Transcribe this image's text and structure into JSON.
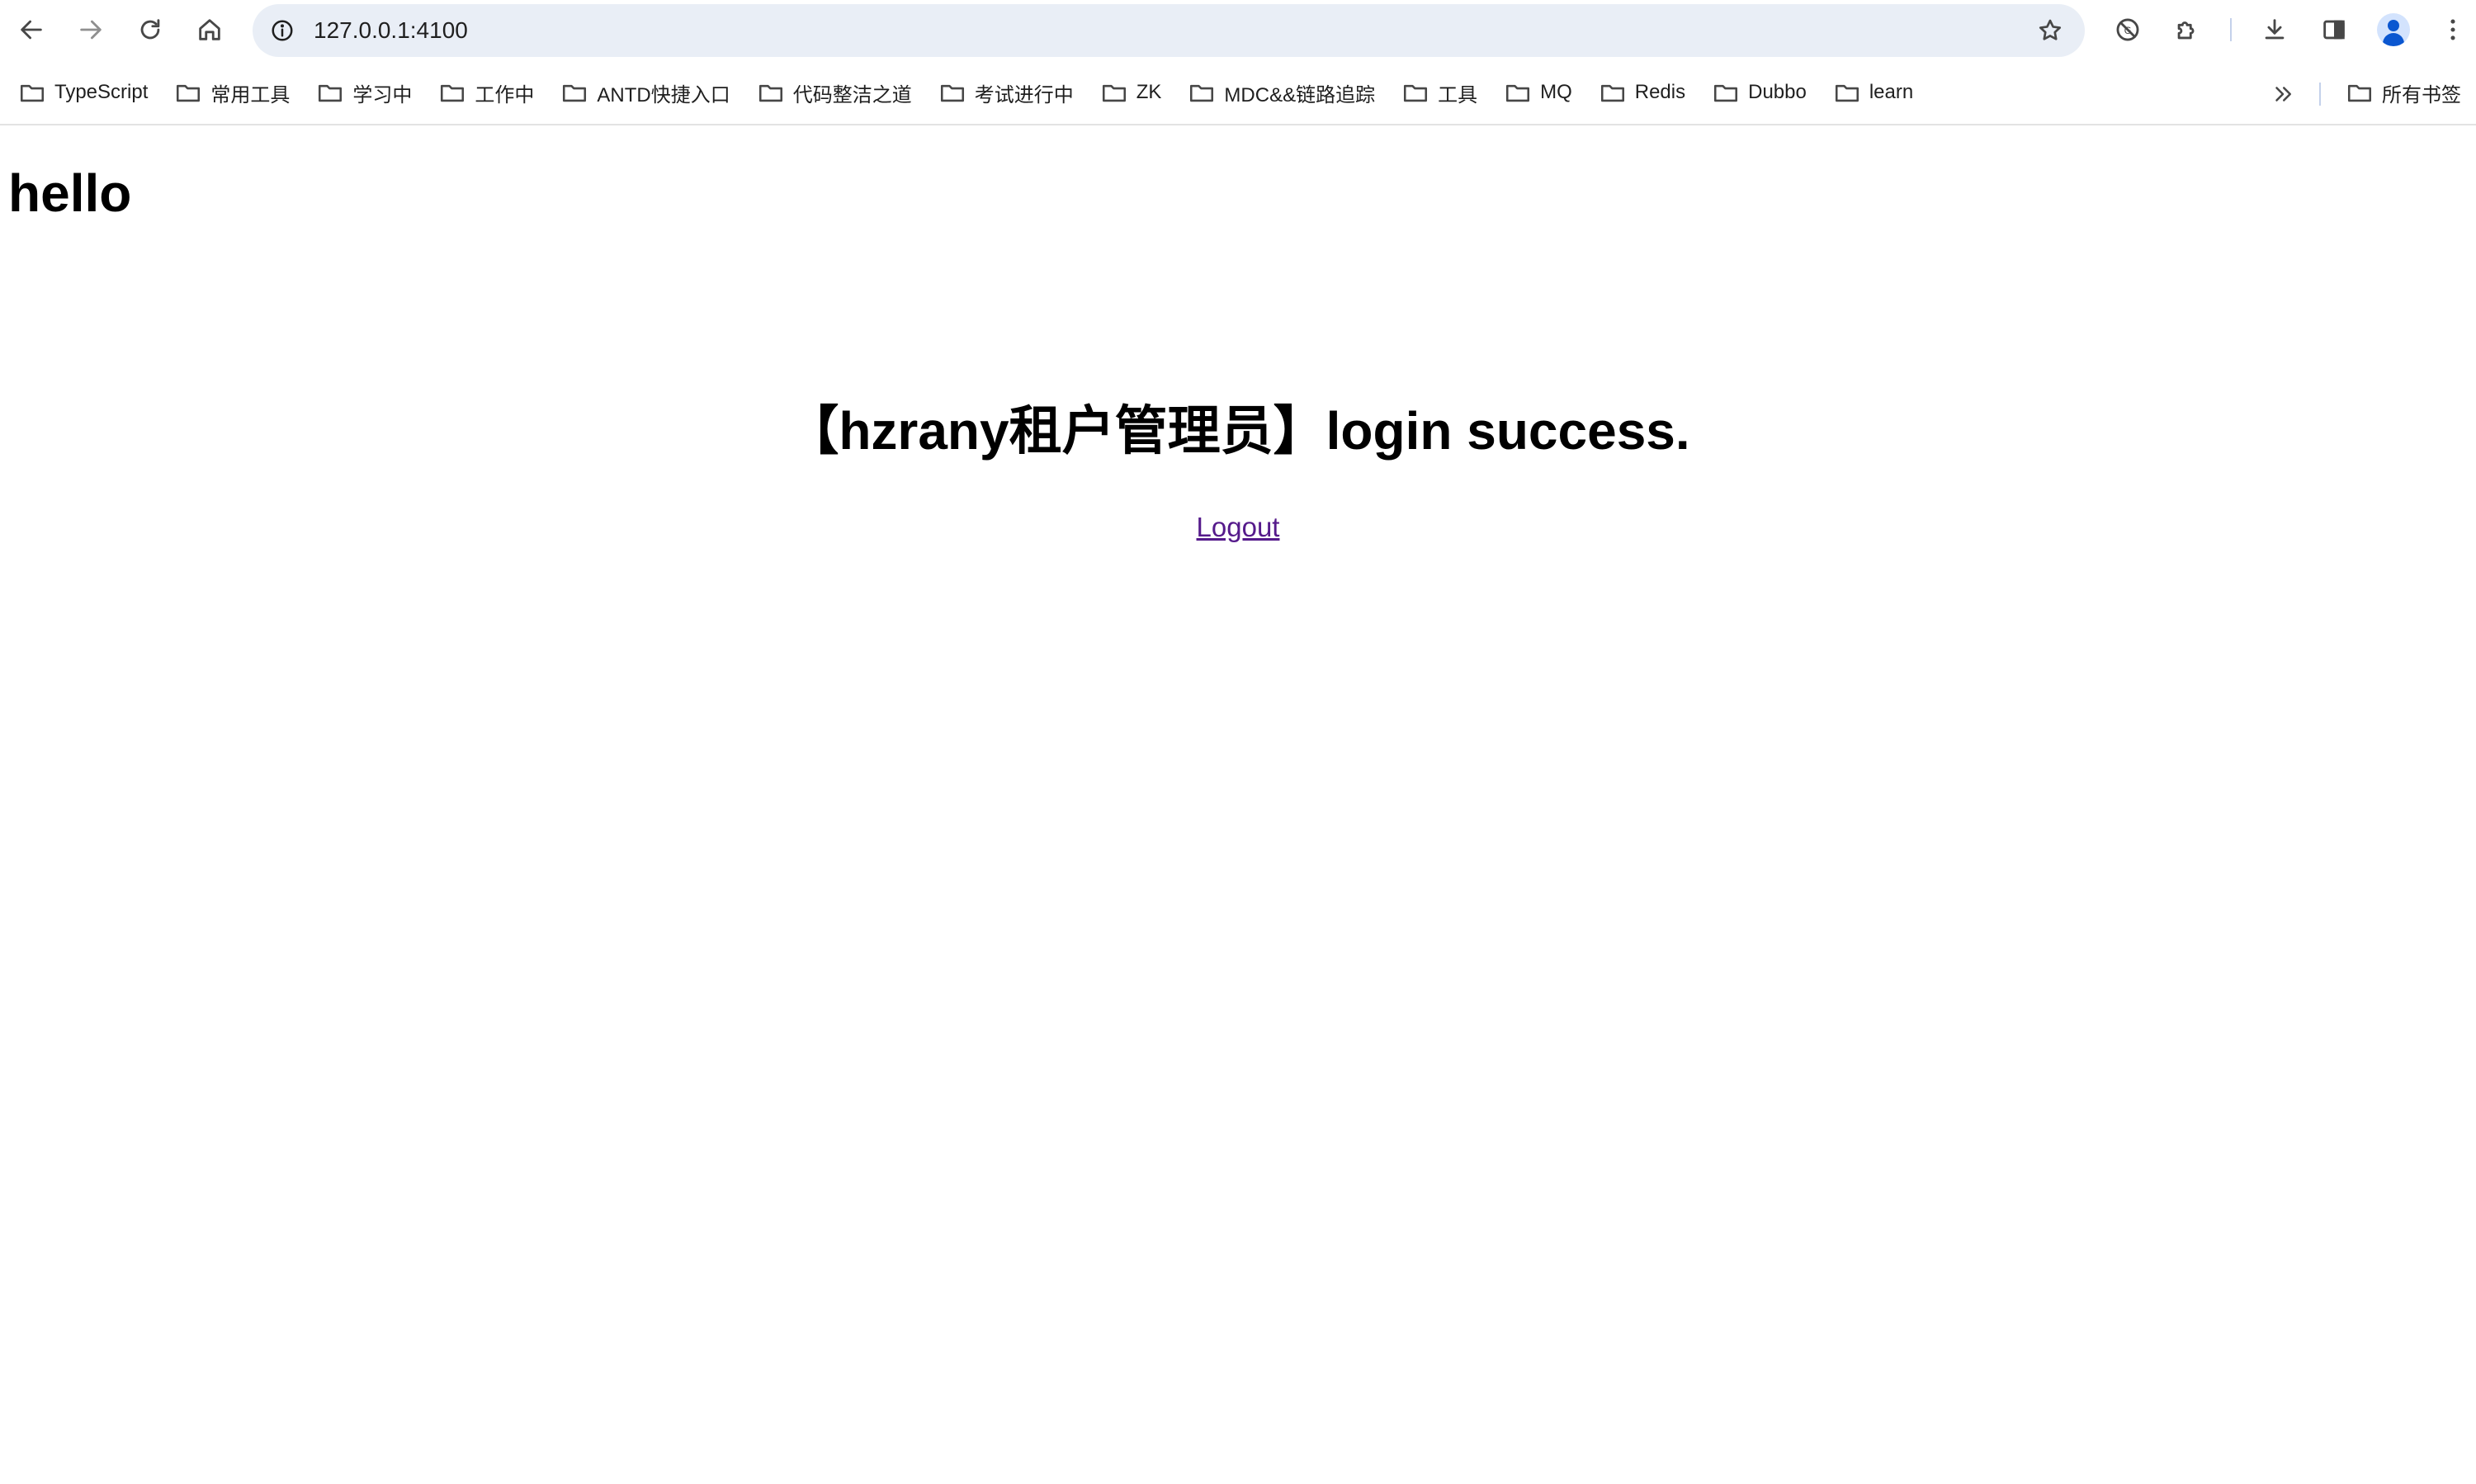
{
  "toolbar": {
    "url": "127.0.0.1:4100",
    "icons": [
      "back-icon",
      "forward-icon",
      "reload-icon",
      "home-icon",
      "site-info-icon",
      "bookmark-star-icon",
      "translate-icon",
      "extensions-icon",
      "download-icon",
      "side-panel-icon",
      "profile-avatar",
      "menu-icon"
    ]
  },
  "bookmarks": {
    "items": [
      {
        "label": "TypeScript"
      },
      {
        "label": "常用工具"
      },
      {
        "label": "学习中"
      },
      {
        "label": "工作中"
      },
      {
        "label": "ANTD快捷入口"
      },
      {
        "label": "代码整洁之道"
      },
      {
        "label": "考试进行中"
      },
      {
        "label": "ZK"
      },
      {
        "label": "MDC&&链路追踪"
      },
      {
        "label": "工具"
      },
      {
        "label": "MQ"
      },
      {
        "label": "Redis"
      },
      {
        "label": "Dubbo"
      },
      {
        "label": "learn"
      }
    ],
    "all_bookmarks_label": "所有书签"
  },
  "page": {
    "greeting": "hello",
    "message": "【hzrany租户管理员】login success.",
    "logout_link": "Logout"
  },
  "colors": {
    "omnibox_bg": "#e9eef6",
    "visited_link": "#551a8b",
    "avatar_accent": "#0b57d0"
  }
}
